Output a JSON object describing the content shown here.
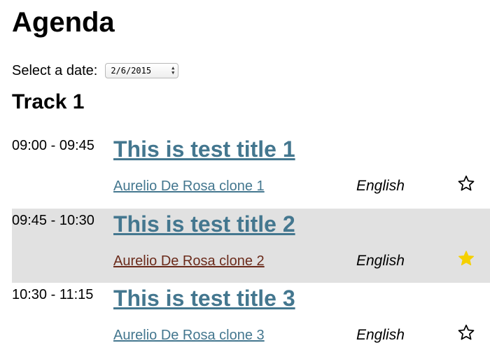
{
  "page": {
    "title": "Agenda"
  },
  "date_picker": {
    "label": "Select a date:",
    "value": "2/6/2015"
  },
  "track": {
    "title": "Track 1"
  },
  "sessions": [
    {
      "time": "09:00 - 09:45",
      "title": "This is test title 1",
      "speaker": "Aurelio De Rosa clone 1",
      "language": "English",
      "favorite": false
    },
    {
      "time": "09:45 - 10:30",
      "title": "This is test title 2",
      "speaker": "Aurelio De Rosa clone 2",
      "language": "English",
      "favorite": true
    },
    {
      "time": "10:30 - 11:15",
      "title": "This is test title 3",
      "speaker": "Aurelio De Rosa clone 3",
      "language": "English",
      "favorite": false
    }
  ],
  "colors": {
    "link": "#44778f",
    "visited_link": "#6b2b1b",
    "highlight_row": "#e1e1e1",
    "star_filled": "#f5d000",
    "star_outline": "#000000"
  },
  "icons": {
    "favorite": "star-icon"
  }
}
